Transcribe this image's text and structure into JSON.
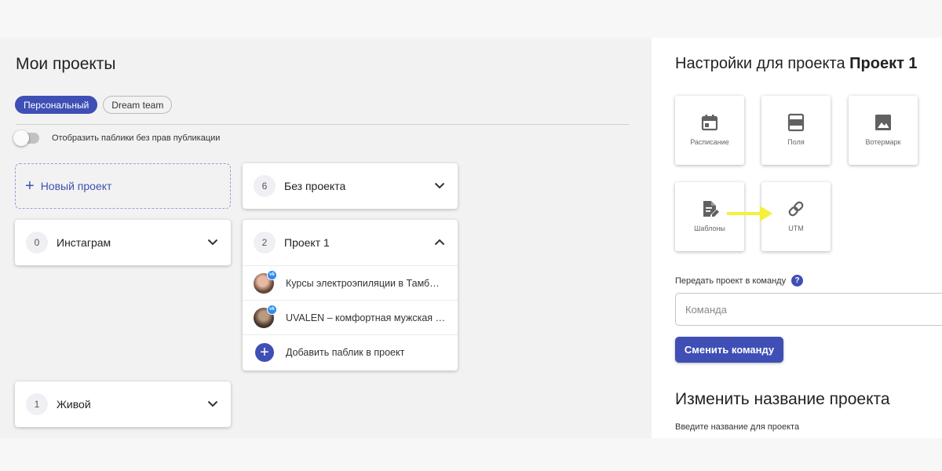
{
  "projects": {
    "title": "Мои проекты",
    "tabs": [
      {
        "label": "Персональный",
        "active": true
      },
      {
        "label": "Dream team",
        "active": false
      }
    ],
    "toggle_label": "Отобразить паблики без прав публикации",
    "new_project_label": "Новый проект",
    "cards": [
      {
        "count": "0",
        "name": "Инстаграм",
        "expanded": false
      },
      {
        "count": "1",
        "name": "Живой",
        "expanded": false
      },
      {
        "count": "6",
        "name": "Без проекта",
        "expanded": false
      },
      {
        "count": "2",
        "name": "Проект 1",
        "expanded": true,
        "publics": [
          {
            "name": "Курсы электроэпиляции в Тамб…",
            "network": "VK"
          },
          {
            "name": "UVALEN – комфортная мужская …",
            "network": "VK"
          }
        ],
        "add_public_label": "Добавить паблик в проект"
      }
    ]
  },
  "settings": {
    "title_prefix": "Настройки для проекта ",
    "project_name": "Проект 1",
    "tiles": [
      {
        "label": "Расписание",
        "icon": "calendar-icon"
      },
      {
        "label": "Поля",
        "icon": "fields-icon"
      },
      {
        "label": "Вотермарк",
        "icon": "image-icon"
      },
      {
        "label": "Шаблоны",
        "icon": "template-icon"
      },
      {
        "label": "UTM",
        "icon": "link-icon"
      }
    ],
    "team_label": "Передать проект в команду",
    "team_placeholder": "Команда",
    "change_team_button": "Сменить команду",
    "rename_title": "Изменить название проекта",
    "rename_hint": "Введите название для проекта"
  },
  "colors": {
    "accent": "#3f4fb5",
    "arrow": "#f5f03a",
    "vk_badge": "#2e8df0"
  }
}
